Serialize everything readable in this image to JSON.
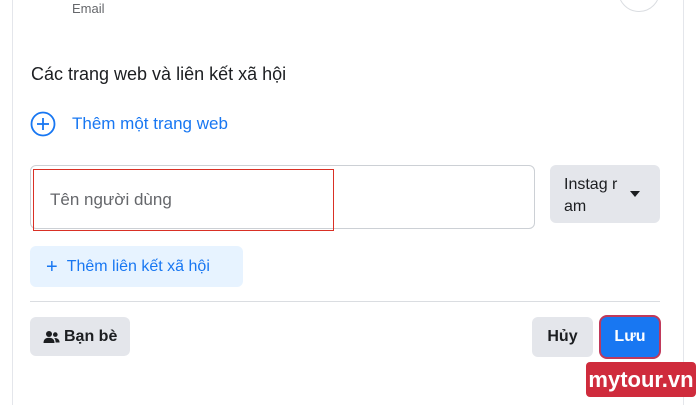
{
  "top": {
    "email_caption": "Email"
  },
  "section": {
    "title": "Các trang web và liên kết xã hội"
  },
  "add_website": {
    "label": "Thêm một trang web",
    "icon": "plus-circle-icon"
  },
  "social_link": {
    "username_placeholder": "Tên người dùng",
    "username_value": "",
    "network_value": "Instag ram"
  },
  "add_social": {
    "plus": "+",
    "label": "Thêm liên kết xã hội"
  },
  "footer": {
    "audience_label": "Bạn bè",
    "cancel_label": "Hủy",
    "save_label": "Lưu"
  },
  "watermark": {
    "text": "mytour.vn"
  },
  "colors": {
    "accent": "#1877f2",
    "accent_light": "#e7f3ff",
    "button_gray": "#e4e6eb",
    "highlight_red": "#d93025",
    "watermark_red": "#cf2b3c"
  }
}
